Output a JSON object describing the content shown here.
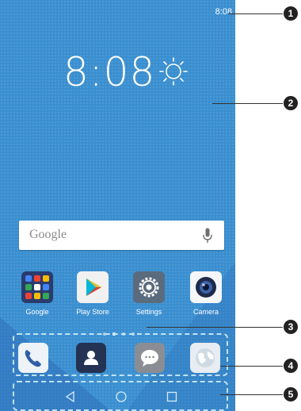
{
  "status_bar": {
    "time": "8:08"
  },
  "clock_widget": {
    "time": "8:08",
    "weather_icon": "sun-icon"
  },
  "search_bar": {
    "logo_text": "Google",
    "mic_icon": "microphone-icon"
  },
  "apps": [
    {
      "label": "Google",
      "icon": "google-folder-icon"
    },
    {
      "label": "Play Store",
      "icon": "play-store-icon"
    },
    {
      "label": "Settings",
      "icon": "settings-gear-icon"
    },
    {
      "label": "Camera",
      "icon": "camera-icon"
    }
  ],
  "page_indicator": {
    "count": 4,
    "active_index": 1
  },
  "dock": [
    {
      "icon": "phone-icon"
    },
    {
      "icon": "contacts-icon"
    },
    {
      "icon": "messages-icon"
    },
    {
      "icon": "browser-icon"
    }
  ],
  "nav_bar": {
    "buttons": [
      "back-icon",
      "home-icon",
      "recents-icon"
    ]
  },
  "callouts": [
    "1",
    "2",
    "3",
    "4",
    "5"
  ],
  "colors": {
    "wallpaper": "#3a8fd0",
    "highlight_dashes": "#bfe3f3",
    "callout": "#222222"
  }
}
